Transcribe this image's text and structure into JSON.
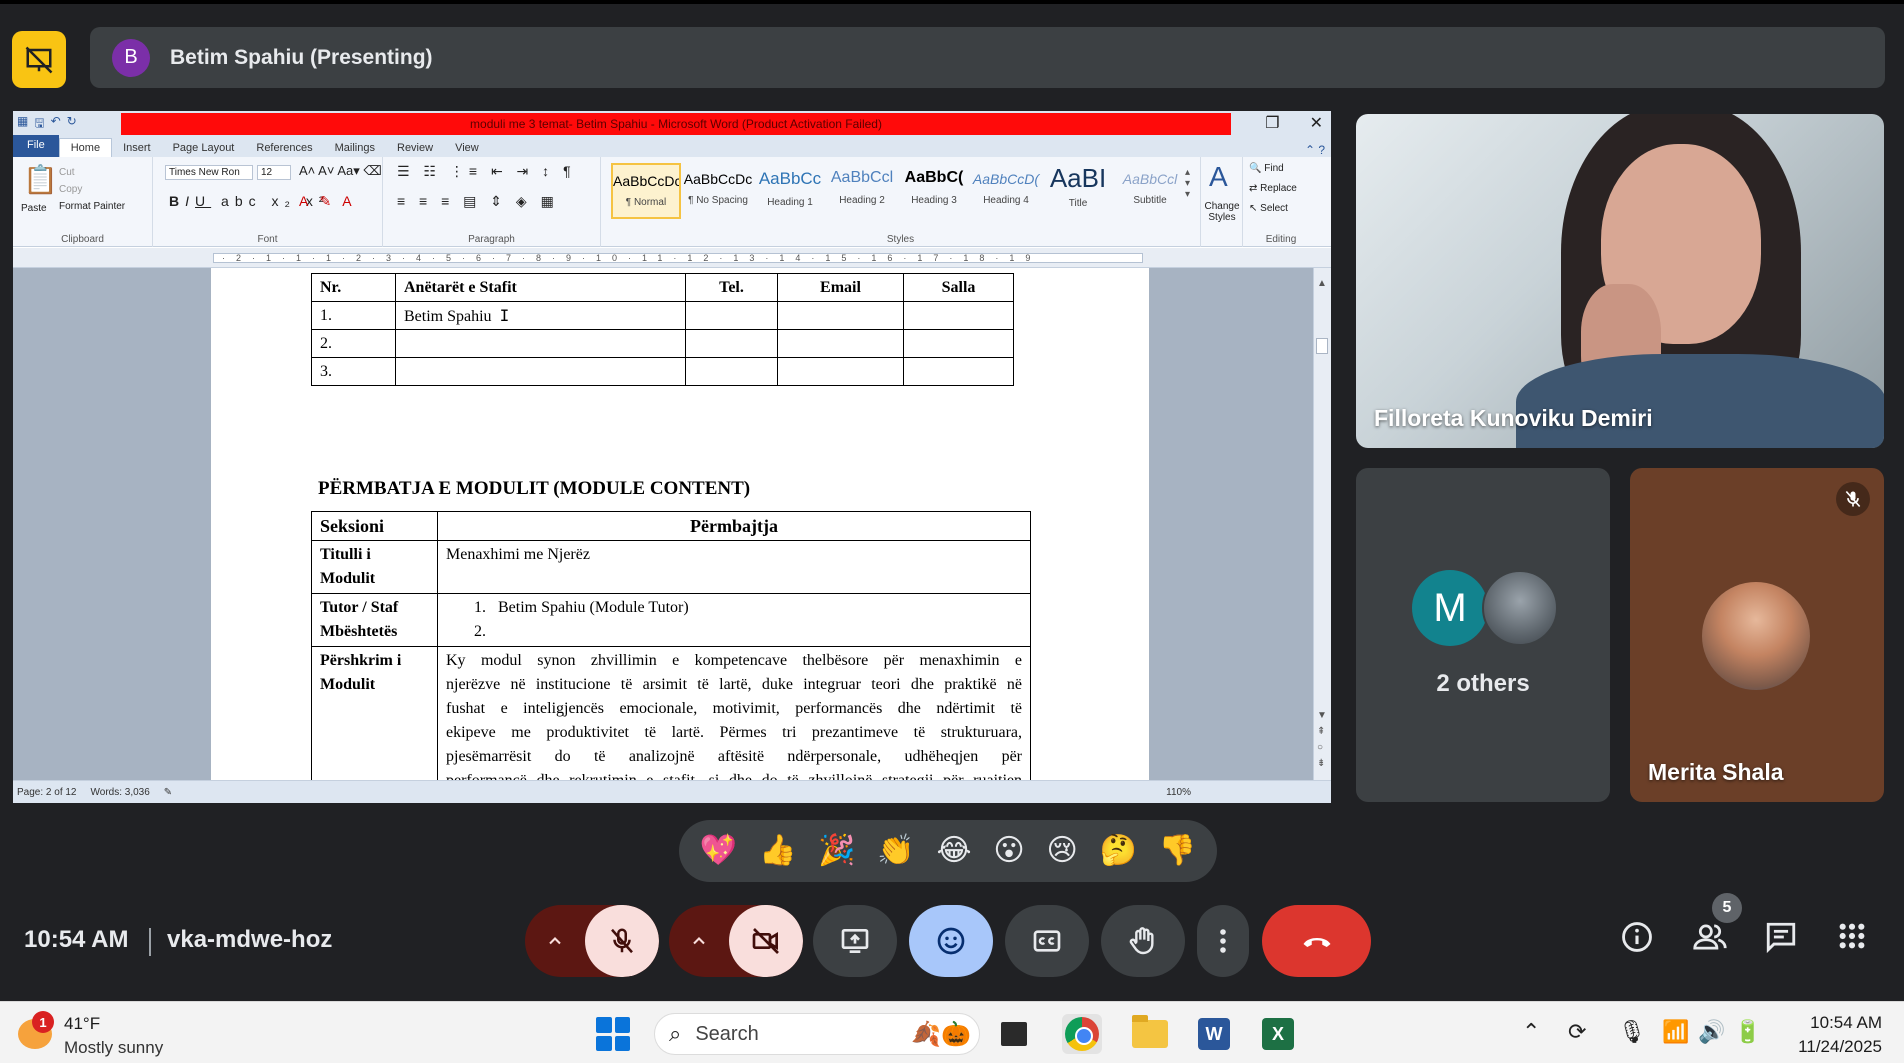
{
  "meet": {
    "presenter_initial": "B",
    "presenter_label": "Betim Spahiu (Presenting)",
    "time": "10:54 AM",
    "meeting_code": "vka-mdwe-hoz",
    "participant_count": "5",
    "reactions": [
      "💖",
      "👍",
      "🎉",
      "👏",
      "😂",
      "😮",
      "😢",
      "🤔",
      "👎"
    ]
  },
  "participants": {
    "main_name": "Filloreta Kunoviku Demiri",
    "others_initial": "M",
    "others_label": "2 others",
    "merita_name": "Merita Shala"
  },
  "word": {
    "title": "moduli me 3 temat- Betim Spahiu - Microsoft Word (Product Activation Failed)",
    "tabs": [
      "File",
      "Home",
      "Insert",
      "Page Layout",
      "References",
      "Mailings",
      "Review",
      "View"
    ],
    "clipboard": {
      "paste": "Paste",
      "cut": "Cut",
      "copy": "Copy",
      "format_painter": "Format Painter",
      "label": "Clipboard"
    },
    "font": {
      "name": "Times New Ron",
      "size": "12",
      "label": "Font"
    },
    "paragraph_label": "Paragraph",
    "styles": [
      {
        "sample": "AaBbCcDc",
        "name": "¶ Normal"
      },
      {
        "sample": "AaBbCcDc",
        "name": "¶ No Spacing"
      },
      {
        "sample": "AaBbCc",
        "name": "Heading 1"
      },
      {
        "sample": "AaBbCcl",
        "name": "Heading 2"
      },
      {
        "sample": "AaBbC(",
        "name": "Heading 3"
      },
      {
        "sample": "AaBbCcD(",
        "name": "Heading 4"
      },
      {
        "sample": "AaBI",
        "name": "Title"
      },
      {
        "sample": "AaBbCcl",
        "name": "Subtitle"
      }
    ],
    "styles_label": "Styles",
    "change_styles": "Change Styles",
    "editing": {
      "find": "Find",
      "replace": "Replace",
      "select": "Select",
      "label": "Editing"
    },
    "status": {
      "page": "Page: 2 of 12",
      "words": "Words: 3,036",
      "zoom": "110%"
    }
  },
  "document": {
    "staff_table": {
      "headers": [
        "Nr.",
        "Anëtarët e Stafit",
        "Tel.",
        "Email",
        "Salla"
      ],
      "rows": [
        [
          "1.",
          "Betim Spahiu",
          "",
          "",
          ""
        ],
        [
          "2.",
          "",
          "",
          "",
          ""
        ],
        [
          "3.",
          "",
          "",
          "",
          ""
        ]
      ]
    },
    "content_heading": "PËRMBATJA E MODULIT (MODULE CONTENT)",
    "content_table": {
      "h_section": "Seksioni",
      "h_content": "Përmbajtja",
      "title_label": "Titulli i Modulit",
      "title_value": "Menaxhimi me Njerëz",
      "tutor_label": "Tutor / Staf Mbështetës",
      "tutor_1": "1.   Betim Spahiu (Module Tutor)",
      "tutor_2": "2.",
      "desc_label": "Përshkrim i Modulit",
      "desc_lines": [
        "Ky modul synon zhvillimin e kompetencave thelbësore për menaxhimin e",
        "njerëzve në institucione të arsimit të lartë, duke integruar teori dhe praktikë në",
        "fushat e inteligjencës emocionale, motivimit, performancës dhe ndërtimit të",
        "ekipeve me produktivitet të lartë. Përmes tri prezantimeve të strukturuara,",
        "pjesëmarrësit do të analizojnë aftësitë ndërpersonale, udhëheqjen për",
        "performancë dhe rekrutimin e stafit, si dhe do të zhvillojnë strategji për ruajtjen"
      ]
    }
  },
  "taskbar": {
    "weather_badge": "1",
    "temperature": "41°F",
    "weather": "Mostly sunny",
    "search": "Search",
    "clock_time": "10:54 AM",
    "clock_date": "11/24/2025"
  }
}
